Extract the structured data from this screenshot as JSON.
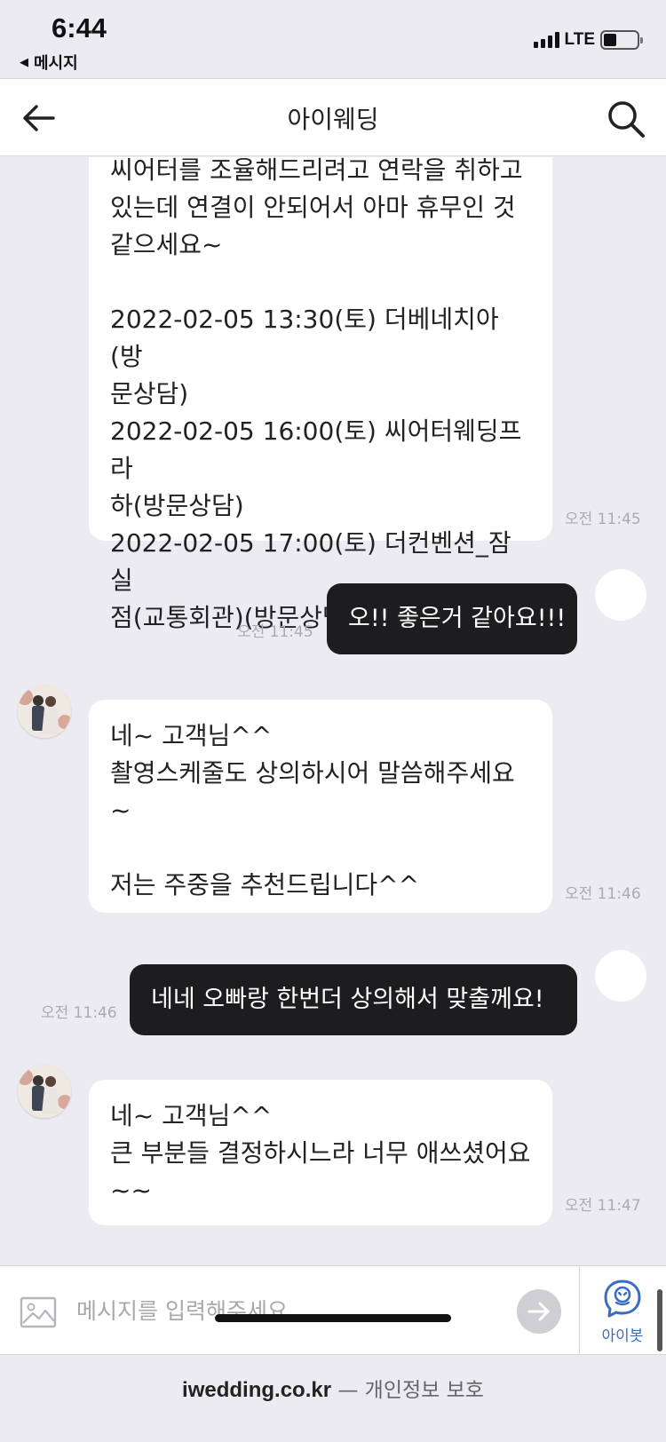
{
  "status_bar": {
    "time": "6:44",
    "back_app": "메시지",
    "network": "LTE"
  },
  "header": {
    "title": "아이웨딩"
  },
  "messages": [
    {
      "from": "agent",
      "text": "씨어터를 조율해드리려고 연락을 취하고\n있는데 연결이 안되어서 아마 휴무인 것\n같으세요~\n\n2022-02-05 13:30(토) 더베네치아(방\n문상담)\n2022-02-05 16:00(토) 씨어터웨딩프라\n하(방문상담)\n2022-02-05 17:00(토) 더컨벤션_잠실\n점(교통회관)(방문상담)",
      "time": "오전 11:45"
    },
    {
      "from": "user",
      "text": "오!! 좋은거 같아요!!!",
      "time": "오전 11:45"
    },
    {
      "from": "agent",
      "text": "네~ 고객님^^\n촬영스케줄도 상의하시어 말씀해주세요\n~\n\n저는 주중을 추천드립니다^^",
      "time": "오전 11:46"
    },
    {
      "from": "user",
      "text": "네네 오빠랑 한번더 상의해서 맞출께요!",
      "time": "오전 11:46"
    },
    {
      "from": "agent",
      "text": "네~ 고객님^^\n큰 부분들 결정하시느라 너무 애쓰셨어요\n~~",
      "time": "오전 11:47"
    }
  ],
  "input": {
    "placeholder": "메시지를 입력해주세요."
  },
  "bot": {
    "label": "아이봇"
  },
  "footer": {
    "domain": "iwedding.co.kr",
    "suffix": " — 개인정보 보호"
  },
  "colors": {
    "background": "#ebebf1",
    "user_bubble": "#1d1d1f",
    "agent_bubble": "#ffffff",
    "accent": "#3a6cc4"
  },
  "icons": [
    "back-arrow-icon",
    "search-icon",
    "image-icon",
    "send-arrow-icon",
    "robot-icon",
    "signal-icon",
    "battery-icon"
  ]
}
